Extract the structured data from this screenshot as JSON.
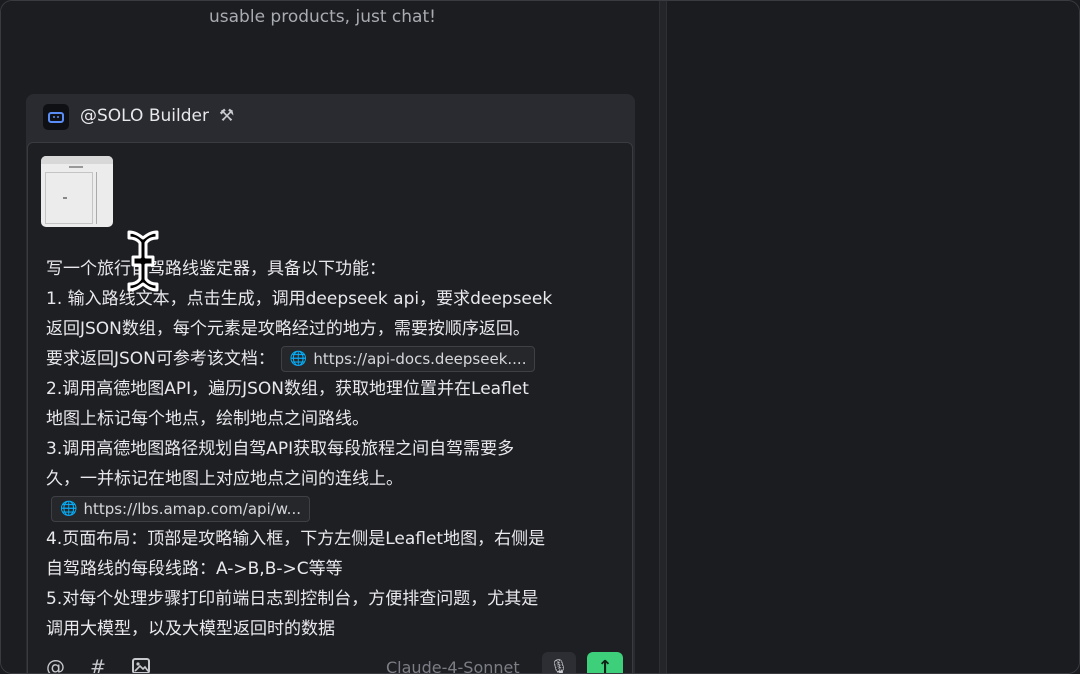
{
  "previous_message": "usable products, just chat!",
  "agent": {
    "name": "@SOLO Builder",
    "tools_icon": "tools-icon",
    "icon": "agent-screen-icon"
  },
  "attachment": {
    "type": "screenshot-thumbnail"
  },
  "prompt_lines": [
    "写一个旅行自驾路线鉴定器，具备以下功能：",
    "1. 输入路线文本，点击生成，调用deepseek api，要求deepseek",
    "返回JSON数组，每个元素是攻略经过的地方，需要按顺序返回。",
    "要求返回JSON可参考该文档：",
    "2.调用高德地图API，遍历JSON数组，获取地理位置并在Leaflet",
    "地图上标记每个地点，绘制地点之间路线。",
    "3.调用高德地图路径规划自驾API获取每段旅程之间自驾需要多",
    "久，一并标记在地图上对应地点之间的连线上。",
    "4.页面布局：顶部是攻略输入框，下方左侧是Leaflet地图，右侧是",
    "自驾路线的每段线路：A->B,B->C等等",
    "5.对每个处理步骤打印前端日志到控制台，方便排查问题，尤其是",
    "调用大模型，以及大模型返回时的数据"
  ],
  "links": {
    "deepseek_docs": "https://api-docs.deepseek....",
    "amap_api": "https://lbs.amap.com/api/w..."
  },
  "toolbar": {
    "mention_icon": "@",
    "hash_icon": "#",
    "image_icon": "image-icon",
    "model": "Claude-4-Sonnet",
    "colors": {
      "send": "#3ecf7a",
      "accent_icon": "#5b8df7"
    }
  }
}
